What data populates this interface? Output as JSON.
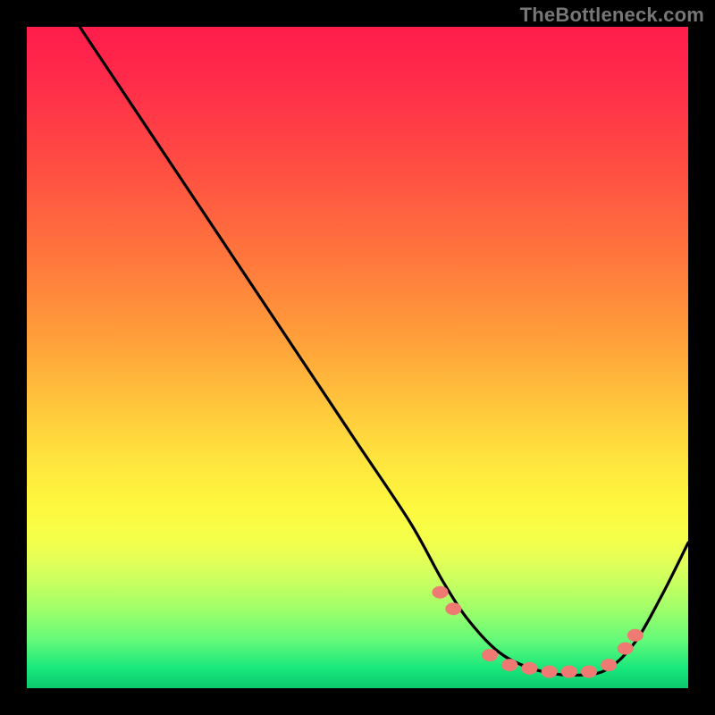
{
  "watermark": "TheBottleneck.com",
  "chart_data": {
    "type": "line",
    "title": "",
    "xlabel": "",
    "ylabel": "",
    "xlim": [
      0,
      100
    ],
    "ylim": [
      0,
      100
    ],
    "grid": false,
    "legend": false,
    "annotations": [],
    "series": [
      {
        "name": "bottleneck-curve",
        "color": "#000000",
        "x": [
          8,
          12,
          20,
          30,
          40,
          50,
          58,
          63,
          67,
          72,
          78,
          84,
          88,
          92,
          96,
          100
        ],
        "y": [
          100,
          94,
          82,
          67,
          52,
          37,
          25,
          16,
          10,
          5,
          2.5,
          2,
          3,
          7,
          14,
          22
        ]
      }
    ],
    "markers": {
      "name": "highlight-dots",
      "color": "#ef7a73",
      "x": [
        62.5,
        64.5,
        70,
        73,
        76,
        79,
        82,
        85,
        88,
        90.5,
        92
      ],
      "y": [
        14.5,
        12,
        5,
        3.5,
        3,
        2.5,
        2.5,
        2.5,
        3.5,
        6,
        8
      ]
    },
    "gradient_stops": [
      {
        "pos": 0,
        "color": "#ff1d4b"
      },
      {
        "pos": 22,
        "color": "#ff5042"
      },
      {
        "pos": 48,
        "color": "#ffa23a"
      },
      {
        "pos": 66,
        "color": "#ffe63e"
      },
      {
        "pos": 84,
        "color": "#c8ff60"
      },
      {
        "pos": 100,
        "color": "#0cc96e"
      }
    ]
  }
}
